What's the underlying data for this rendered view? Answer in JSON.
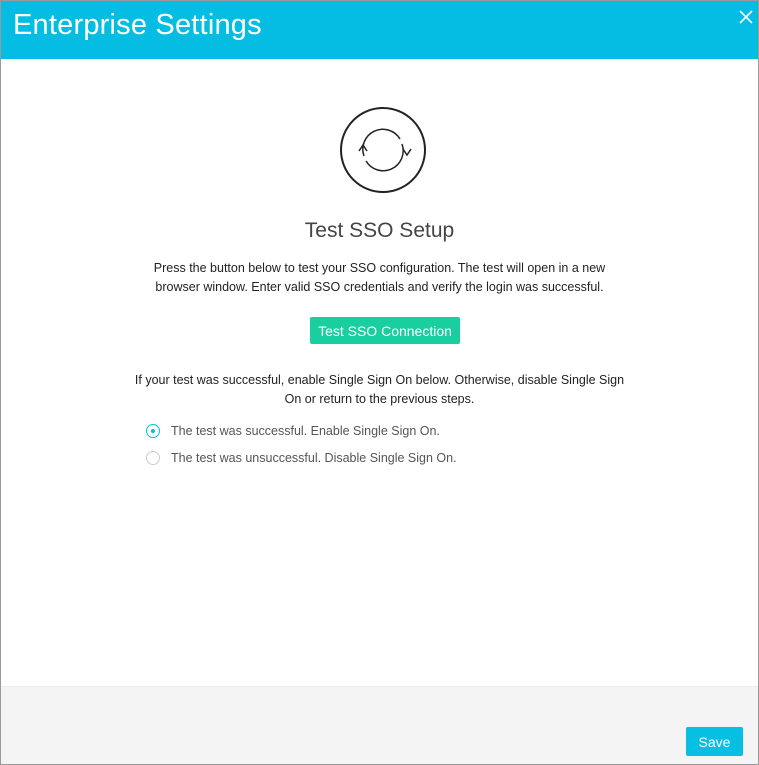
{
  "header": {
    "title": "Enterprise Settings",
    "close_icon": "close-icon"
  },
  "main": {
    "icon": "sync-icon",
    "title": "Test SSO Setup",
    "description": "Press the button below to test your SSO configuration. The test will open in a new browser window. Enter valid SSO credentials and verify the login was successful.",
    "test_button_label": "Test SSO Connection",
    "followup": "If your test was successful, enable Single Sign On below. Otherwise, disable Single Sign On or return to the previous steps.",
    "options": [
      {
        "label": "The test was successful. Enable Single Sign On.",
        "selected": true
      },
      {
        "label": "The test was unsuccessful. Disable Single Sign On.",
        "selected": false
      }
    ]
  },
  "footer": {
    "save_label": "Save"
  },
  "colors": {
    "header": "#05bde3",
    "test_button": "#19cfa0",
    "save_button": "#07bfe2",
    "radio_accent": "#05bde3"
  }
}
